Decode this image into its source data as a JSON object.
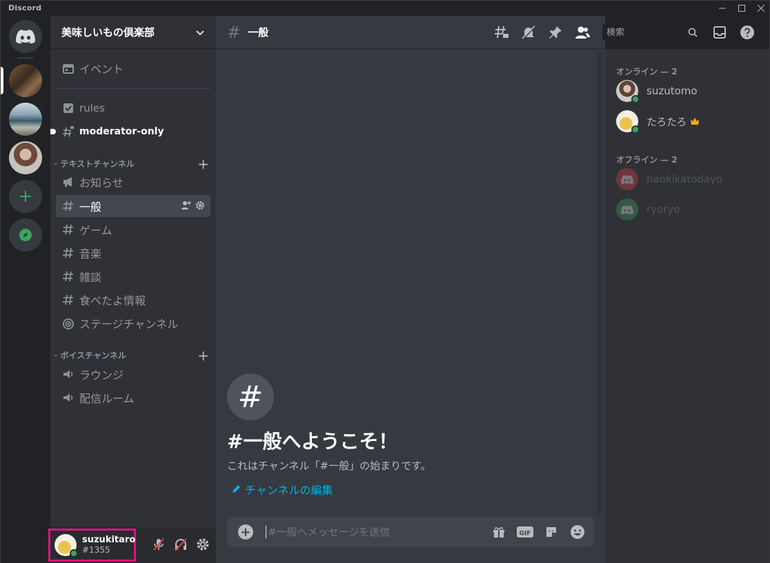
{
  "window": {
    "title": "Discord"
  },
  "server": {
    "name": "美味しいもの倶楽部"
  },
  "sidebar": {
    "top_items": [
      {
        "label": "イベント",
        "icon": "calendar-icon"
      },
      {
        "label": "rules",
        "icon": "rules-icon"
      },
      {
        "label": "moderator-only",
        "icon": "locked-hash-icon"
      }
    ],
    "text_category": "テキストチャンネル",
    "text_channels": [
      {
        "label": "お知らせ",
        "icon": "announcement-icon"
      },
      {
        "label": "一般",
        "icon": "hash-icon"
      },
      {
        "label": "ゲーム",
        "icon": "hash-icon"
      },
      {
        "label": "音楽",
        "icon": "hash-icon"
      },
      {
        "label": "雑談",
        "icon": "hash-icon"
      },
      {
        "label": "食べたよ情報",
        "icon": "hash-icon"
      },
      {
        "label": "ステージチャンネル",
        "icon": "stage-icon"
      }
    ],
    "voice_category": "ボイスチャンネル",
    "voice_channels": [
      {
        "label": "ラウンジ",
        "icon": "speaker-icon"
      },
      {
        "label": "配信ルーム",
        "icon": "speaker-icon"
      }
    ]
  },
  "user": {
    "name": "suzukitaro",
    "tag": "#1355"
  },
  "chat": {
    "channel": "一般",
    "welcome_title": "#一般へようこそ！",
    "welcome_sub": "これはチャンネル「#一般」の始まりです。",
    "edit_link": "チャンネルの編集",
    "placeholder": "#一般へメッセージを送信"
  },
  "search": {
    "placeholder": "検索"
  },
  "members": {
    "online_header": "オンライン — 2",
    "online": [
      {
        "name": "suzutomo"
      },
      {
        "name": "たろたろ",
        "owner": true
      }
    ],
    "offline_header": "オフライン — 2",
    "offline": [
      {
        "name": "naokikatodayo",
        "color": "#ed4245"
      },
      {
        "name": "ryoryo",
        "color": "#3ba55d"
      }
    ]
  },
  "colors": {
    "accent": "#5865f2",
    "online": "#3ba55d",
    "link": "#00aff4",
    "highlight": "#e0127e"
  }
}
